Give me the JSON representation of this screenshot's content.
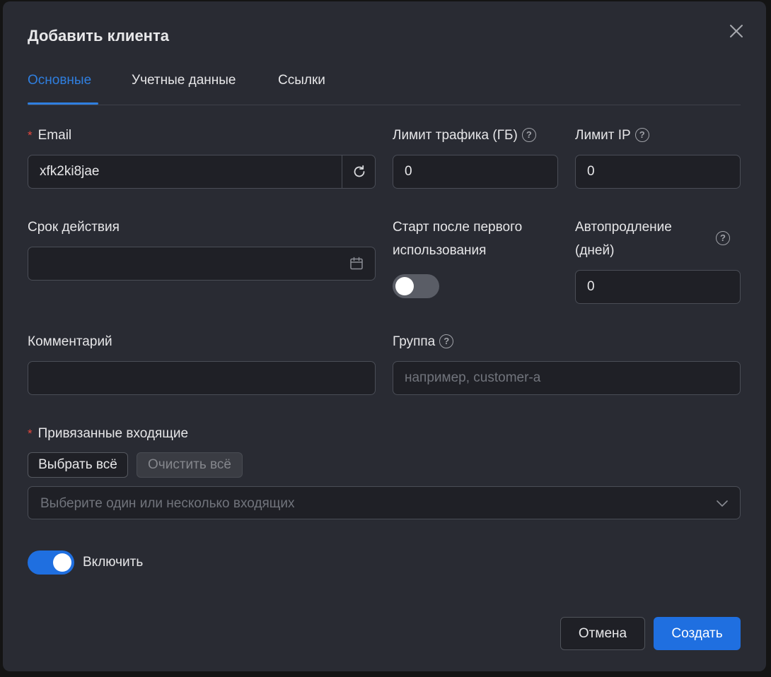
{
  "dialog": {
    "title": "Добавить клиента"
  },
  "tabs": [
    {
      "label": "Основные",
      "active": true
    },
    {
      "label": "Учетные данные",
      "active": false
    },
    {
      "label": "Ссылки",
      "active": false
    }
  ],
  "fields": {
    "email": {
      "label": "Email",
      "required": true,
      "value": "xfk2ki8jae"
    },
    "traffic_limit": {
      "label": "Лимит трафика (ГБ)",
      "value": "0"
    },
    "ip_limit": {
      "label": "Лимит IP",
      "value": "0"
    },
    "expiry": {
      "label": "Срок действия",
      "value": ""
    },
    "start_after_first_use": {
      "label": "Старт после первого использования",
      "enabled": false
    },
    "auto_renew": {
      "label": "Автопродление (дней)",
      "value": "0"
    },
    "comment": {
      "label": "Комментарий",
      "value": ""
    },
    "group": {
      "label": "Группа",
      "value": "",
      "placeholder": "например, customer-a"
    },
    "inbounds": {
      "label": "Привязанные входящие",
      "required": true,
      "select_all_label": "Выбрать всё",
      "clear_all_label": "Очистить всё",
      "placeholder": "Выберите один или несколько входящих"
    },
    "enable": {
      "label": "Включить",
      "enabled": true
    }
  },
  "footer": {
    "cancel_label": "Отмена",
    "create_label": "Создать"
  },
  "colors": {
    "accent": "#1f6fe0",
    "background": "#292b33",
    "input_bg": "#1f2026",
    "required": "#e5483e"
  },
  "icons": [
    "close-icon",
    "refresh-icon",
    "calendar-icon",
    "help-icon",
    "chevron-down-icon"
  ]
}
